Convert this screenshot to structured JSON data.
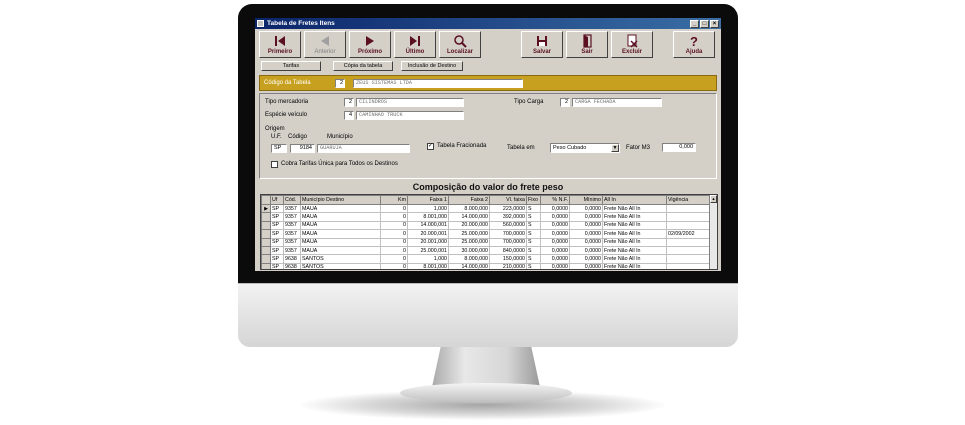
{
  "window": {
    "title": "Tabela de Fretes Itens",
    "controls": [
      "_",
      "□",
      "×"
    ]
  },
  "toolbar": {
    "first": "Primeiro",
    "previous": "Anterior",
    "next": "Próximo",
    "last": "Último",
    "find": "Localizar",
    "save": "Salvar",
    "exit": "Sair",
    "delete": "Excluir",
    "help": "Ajuda"
  },
  "tabs": [
    "Tarifas",
    "Cópia da tabela",
    "Inclusão de Destino"
  ],
  "header": {
    "label": "Código da Tabela",
    "code": "2",
    "value": "ZEUS SISTEMAS LTDA"
  },
  "form": {
    "tipo_mercadoria_label": "Tipo mercadoria",
    "tipo_mercadoria_code": "2",
    "tipo_mercadoria_value": "CILINDROS",
    "tipo_carga_label": "Tipo Carga",
    "tipo_carga_code": "2",
    "tipo_carga_value": "CARGA FECHADA",
    "especie_label": "Espécie veículo",
    "especie_code": "4",
    "especie_value": "CAMINHÃO TRUCK",
    "origem_label": "Origem",
    "uf_label": "U.F.",
    "codigo_label": "Código",
    "municipio_label": "Município",
    "uf_value": "SP",
    "codigo_value": "9184",
    "municipio_value": "GUARUJA",
    "fracionada_label": "Tabela Fracionada",
    "fracionada_checked": "✓",
    "tabela_em_label": "Tabela em",
    "tabela_em_value": "Peso Cubado",
    "fator_label": "Fator M3",
    "fator_value": "0,000",
    "cobra_label": "Cobra Tarifas Única para Todos os Destinos"
  },
  "section_title": "Composição do valor do frete peso",
  "grid": {
    "columns": [
      "Uf",
      "Cód.",
      "Município Destino",
      "Km",
      "Faixa 1",
      "Faixa 2",
      "Vl. faixa",
      "Fixo",
      "% N.F.",
      "Mínimo",
      "All In",
      "Vigência"
    ],
    "rows": [
      [
        "SP",
        "9357",
        "MAUA",
        "0",
        "1,000",
        "8.000,000",
        "223,0000",
        "S",
        "0,0000",
        "0,0000",
        "Frete Não All In",
        ""
      ],
      [
        "SP",
        "9357",
        "MAUA",
        "0",
        "8.001,000",
        "14.000,000",
        "392,0000",
        "S",
        "0,0000",
        "0,0000",
        "Frete Não All In",
        ""
      ],
      [
        "SP",
        "9357",
        "MAUA",
        "0",
        "14.000,001",
        "20.000,000",
        "560,0000",
        "S",
        "0,0000",
        "0,0000",
        "Frete Não All In",
        ""
      ],
      [
        "SP",
        "9357",
        "MAUA",
        "0",
        "20.000,001",
        "25.000,000",
        "700,0000",
        "S",
        "0,0000",
        "0,0000",
        "Frete Não All In",
        "02/09/2002"
      ],
      [
        "SP",
        "9357",
        "MAUA",
        "0",
        "20.001,000",
        "25.000,000",
        "700,0000",
        "S",
        "0,0000",
        "0,0000",
        "Frete Não All In",
        ""
      ],
      [
        "SP",
        "9357",
        "MAUA",
        "0",
        "25.000,001",
        "30.000,000",
        "840,0000",
        "S",
        "0,0000",
        "0,0000",
        "Frete Não All In",
        ""
      ],
      [
        "SP",
        "9638",
        "SANTOS",
        "0",
        "1,000",
        "8.000,000",
        "150,0000",
        "S",
        "0,0000",
        "0,0000",
        "Frete Não All In",
        ""
      ],
      [
        "SP",
        "9638",
        "SANTOS",
        "0",
        "8.001,000",
        "14.000,000",
        "210,0000",
        "S",
        "0,0000",
        "0,0000",
        "Frete Não All In",
        ""
      ]
    ]
  },
  "colors": {
    "accent_band": "#c8a020",
    "title_bar": "#0a246a",
    "button_text": "#5a1020"
  }
}
